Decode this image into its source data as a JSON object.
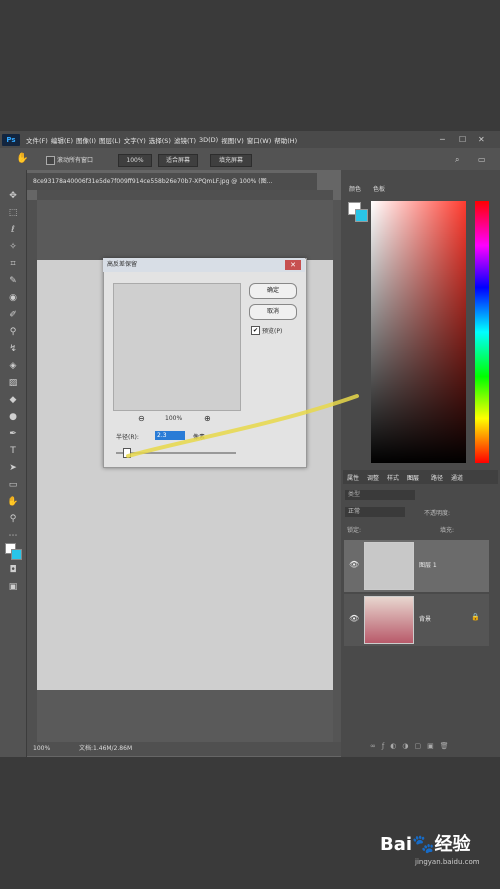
{
  "menubar": {
    "logo": "Ps",
    "items": [
      "文件(F)",
      "编辑(E)",
      "图像(I)",
      "图层(L)",
      "文字(Y)",
      "选择(S)",
      "滤镜(T)",
      "3D(D)",
      "视图(V)",
      "窗口(W)",
      "帮助(H)"
    ]
  },
  "options": {
    "scroll_all_label": "滚动所有窗口",
    "zoom_value": "100%",
    "fit_screen": "适合屏幕",
    "fill_screen": "填充屏幕"
  },
  "document": {
    "tab_title": "8ce93178a40006f31e5de7f009ff914ce558b26e70b7-XPQmLF.jpg @ 100% (图...",
    "zoom": "100%",
    "doc_info": "文档:1.46M/2.86M"
  },
  "color_panel": {
    "tab_color": "颜色",
    "tab_swatches": "色板",
    "fg_color": "#ffffff",
    "bg_color": "#29c5e8"
  },
  "layers_panel": {
    "tabs": [
      "属性",
      "调整",
      "样式",
      "图层",
      "路径",
      "通道"
    ],
    "search_placeholder": "类型",
    "blend_mode": "正常",
    "opacity_label": "不透明度:",
    "lock_label": "锁定:",
    "fill_label": "填充:",
    "layers": [
      {
        "name": "图层 1",
        "selected": true
      },
      {
        "name": "背景",
        "selected": false,
        "locked": true
      }
    ]
  },
  "dialog": {
    "title": "高反差保留",
    "ok": "确定",
    "cancel": "取消",
    "preview_label": "预览(P)",
    "preview_checked": true,
    "zoom_value": "100%",
    "radius_label": "半径(R):",
    "radius_value": "2.3",
    "radius_unit": "像素",
    "radius_slider_fraction": 0.08
  },
  "watermark": {
    "logo_text": "Bai🐾经验",
    "url": "jingyan.baidu.com"
  }
}
